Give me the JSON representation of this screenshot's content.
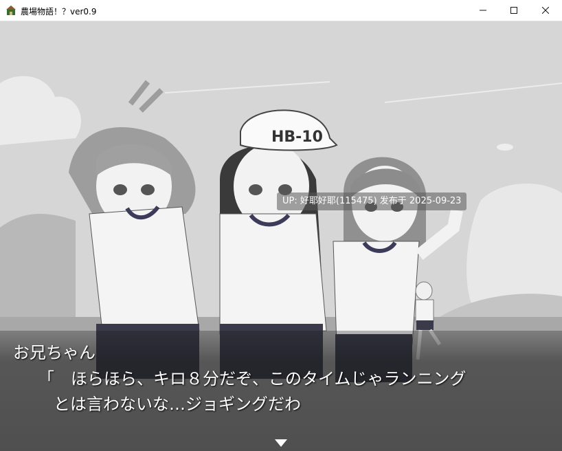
{
  "window": {
    "title": "農場物語！？ver0.9",
    "icon": "game-app-icon",
    "controls": {
      "minimize": "—",
      "maximize": "☐",
      "close": "✕"
    }
  },
  "watermark": {
    "text": "UP: 好耶好耶(115475) 发布于 2025-09-23"
  },
  "cap_text": "HB-10",
  "message": {
    "speaker": "お兄ちゃん",
    "line1": "「　ほらほら、キロ８分だぞ、このタイムじゃランニング",
    "line2": "とは言わないな…ジョギングだわ",
    "next_indicator": "next-page-arrow"
  }
}
